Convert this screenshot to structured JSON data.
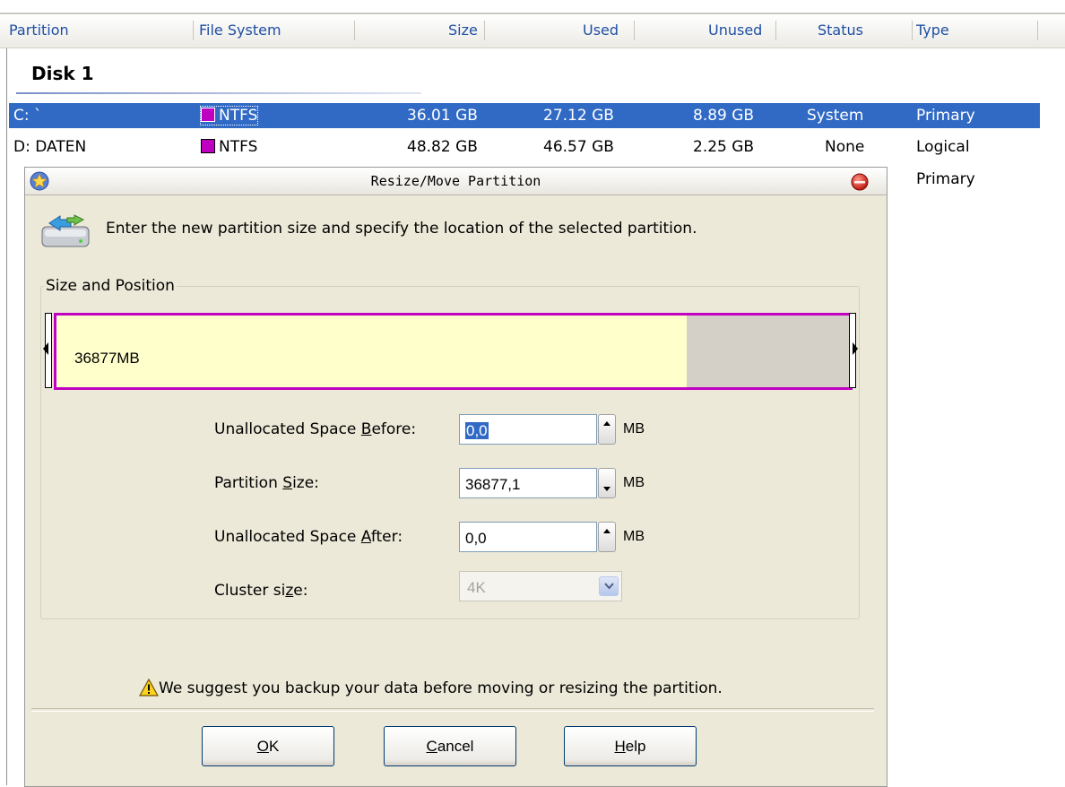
{
  "list": {
    "columns": [
      "Partition",
      "File System",
      "Size",
      "Used",
      "Unused",
      "Status",
      "Type"
    ],
    "disk_label": "Disk 1",
    "rows": [
      {
        "partition": "C: `",
        "file_system": "NTFS",
        "size": "36.01 GB",
        "used": "27.12 GB",
        "unused": "8.89 GB",
        "status": "System",
        "type": "Primary",
        "selected": true
      },
      {
        "partition": "D: DATEN",
        "file_system": "NTFS",
        "size": "48.82 GB",
        "used": "46.57 GB",
        "unused": "2.25 GB",
        "status": "None",
        "type": "Logical",
        "selected": false
      }
    ],
    "partial_row_type": "Primary",
    "fs_color": "#c000c0",
    "selection_color": "#316ac5"
  },
  "dialog": {
    "title": "Resize/Move Partition",
    "instruction": "Enter the new partition size and specify the location of the selected partition.",
    "group_label": "Size and Position",
    "partition_bar": {
      "label": "36877MB",
      "used_fraction": 0.794
    },
    "fields": {
      "before": {
        "label_pre": "Unallocated Space ",
        "label_key": "B",
        "label_post": "efore:",
        "value": "0,0",
        "unit": "MB"
      },
      "size": {
        "label_pre": "Partition ",
        "label_key": "S",
        "label_post": "ize:",
        "value": "36877,1",
        "unit": "MB"
      },
      "after": {
        "label_pre": "Unallocated Space ",
        "label_key": "A",
        "label_post": "fter:",
        "value": "0,0",
        "unit": "MB"
      },
      "cluster": {
        "label_pre": "Cluster si",
        "label_key": "z",
        "label_post": "e:",
        "value": "4K"
      }
    },
    "warning": "We suggest you backup your data before moving or resizing the partition.",
    "buttons": {
      "ok": {
        "key": "O",
        "rest": "K"
      },
      "cancel": {
        "key": "C",
        "rest": "ancel"
      },
      "help": {
        "key": "H",
        "rest": "elp"
      }
    }
  }
}
